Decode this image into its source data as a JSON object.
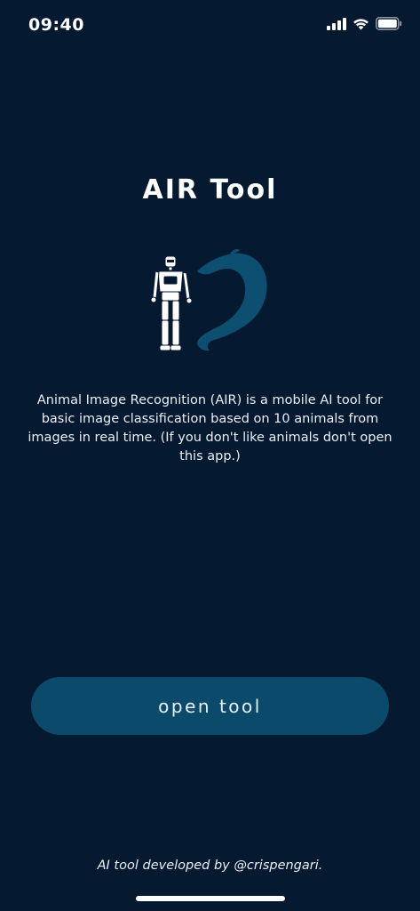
{
  "status_bar": {
    "time": "09:40",
    "icons": [
      "signal-icon",
      "wifi-icon",
      "battery-icon"
    ]
  },
  "main": {
    "title": "AIR Tool",
    "hero_icons": [
      "robot-icon",
      "dolphin-icon"
    ],
    "description": "Animal Image Recognition (AIR) is a mobile AI tool for basic image classification based on 10 animals from images in real time. (If you don't like animals don't open this app.)",
    "open_button_label": "open tool"
  },
  "footer": {
    "credit": "AI tool developed by @crispengari."
  },
  "colors": {
    "background": "#051a31",
    "button": "#0b4a6a",
    "dolphin": "#0d4f71",
    "text": "#ffffff"
  }
}
